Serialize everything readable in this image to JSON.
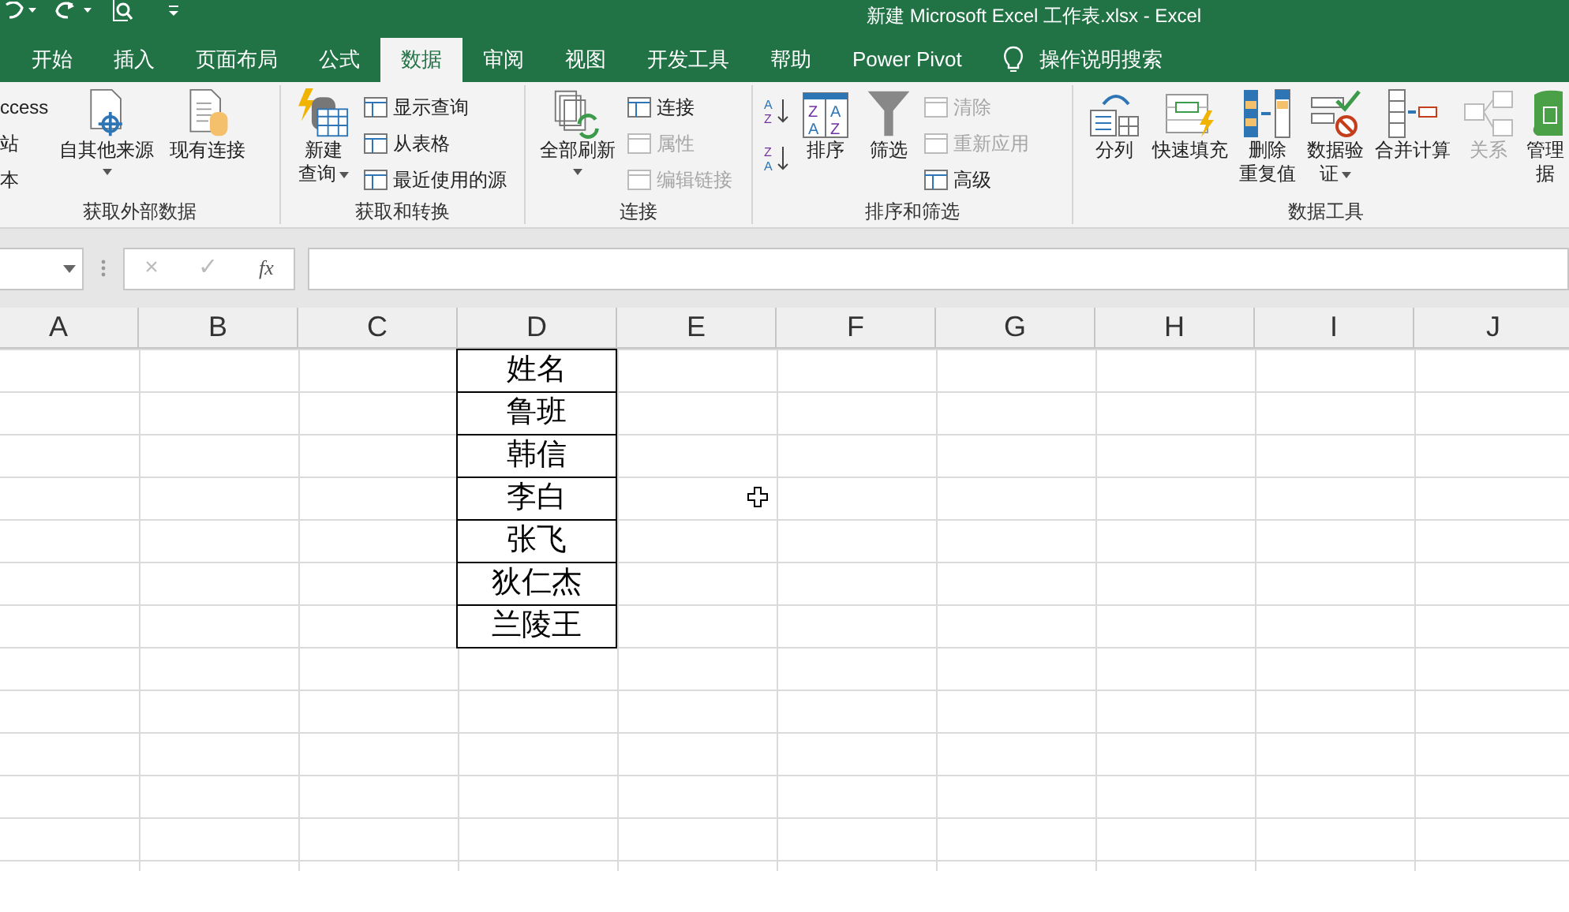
{
  "window": {
    "title": "新建 Microsoft Excel 工作表.xlsx  -  Excel"
  },
  "tabs": [
    {
      "label": "开始",
      "selected": false
    },
    {
      "label": "插入",
      "selected": false
    },
    {
      "label": "页面布局",
      "selected": false
    },
    {
      "label": "公式",
      "selected": false
    },
    {
      "label": "数据",
      "selected": true
    },
    {
      "label": "审阅",
      "selected": false
    },
    {
      "label": "视图",
      "selected": false
    },
    {
      "label": "开发工具",
      "selected": false
    },
    {
      "label": "帮助",
      "selected": false
    },
    {
      "label": "Power Pivot",
      "selected": false
    }
  ],
  "tell_me": {
    "placeholder": "操作说明搜索"
  },
  "ribbon_groups": [
    {
      "label": "获取外部数据",
      "commands": [
        {
          "kind": "stack",
          "items": [
            {
              "label": "ccess",
              "disabled": false
            },
            {
              "label": "站",
              "disabled": false
            },
            {
              "label": "本",
              "disabled": false
            }
          ]
        },
        {
          "kind": "large",
          "lines": [
            "自其他来源"
          ],
          "dropdown": true,
          "disabled": false
        },
        {
          "kind": "large",
          "lines": [
            "现有连接"
          ],
          "dropdown": false,
          "disabled": false
        }
      ]
    },
    {
      "label": "获取和转换",
      "commands": [
        {
          "kind": "large",
          "lines": [
            "新建",
            "查询"
          ],
          "dropdown": true,
          "disabled": false
        },
        {
          "kind": "stack",
          "items": [
            {
              "label": "显示查询",
              "disabled": false
            },
            {
              "label": "从表格",
              "disabled": false
            },
            {
              "label": "最近使用的源",
              "disabled": false
            }
          ]
        }
      ]
    },
    {
      "label": "连接",
      "commands": [
        {
          "kind": "large",
          "lines": [
            "全部刷新"
          ],
          "dropdown": true,
          "disabled": false
        },
        {
          "kind": "stack",
          "items": [
            {
              "label": "连接",
              "disabled": false
            },
            {
              "label": "属性",
              "disabled": true
            },
            {
              "label": "编辑链接",
              "disabled": true
            }
          ]
        }
      ]
    },
    {
      "label": "排序和筛选",
      "commands": [
        {
          "kind": "sortpair",
          "buttons": [
            {
              "top": "A",
              "bottom": "Z"
            },
            {
              "top": "Z",
              "bottom": "A"
            }
          ]
        },
        {
          "kind": "large",
          "lines": [
            "排序"
          ],
          "dropdown": false,
          "disabled": false,
          "icon_letters": [
            "Z",
            "A",
            "A",
            "Z"
          ]
        },
        {
          "kind": "large",
          "lines": [
            "筛选"
          ],
          "dropdown": false,
          "disabled": false
        },
        {
          "kind": "stack",
          "items": [
            {
              "label": "清除",
              "disabled": true
            },
            {
              "label": "重新应用",
              "disabled": true
            },
            {
              "label": "高级",
              "disabled": false
            }
          ]
        }
      ]
    },
    {
      "label": "数据工具",
      "commands": [
        {
          "kind": "large",
          "lines": [
            "分列"
          ],
          "dropdown": false,
          "disabled": false
        },
        {
          "kind": "large",
          "lines": [
            "快速填充"
          ],
          "dropdown": false,
          "disabled": false
        },
        {
          "kind": "large",
          "lines": [
            "删除",
            "重复值"
          ],
          "dropdown": false,
          "disabled": false
        },
        {
          "kind": "large",
          "lines": [
            "数据验",
            "证"
          ],
          "dropdown": true,
          "disabled": false
        },
        {
          "kind": "large",
          "lines": [
            "合并计算"
          ],
          "dropdown": false,
          "disabled": false
        },
        {
          "kind": "large",
          "lines": [
            "关系"
          ],
          "dropdown": false,
          "disabled": true
        },
        {
          "kind": "large",
          "lines": [
            "管理",
            "据"
          ],
          "dropdown": false,
          "disabled": false
        }
      ]
    }
  ],
  "formula_bar": {
    "cancel": "×",
    "enter": "✓",
    "function": "fx"
  },
  "sheet": {
    "columns": [
      {
        "label": "A"
      },
      {
        "label": "B"
      },
      {
        "label": "C"
      },
      {
        "label": "D",
        "cells": [
          "姓名",
          "鲁班",
          "韩信",
          "李白",
          "张飞",
          "狄仁杰",
          "兰陵王"
        ]
      },
      {
        "label": "E"
      },
      {
        "label": "F"
      },
      {
        "label": "G"
      },
      {
        "label": "H"
      },
      {
        "label": "I"
      },
      {
        "label": "J"
      }
    ]
  }
}
